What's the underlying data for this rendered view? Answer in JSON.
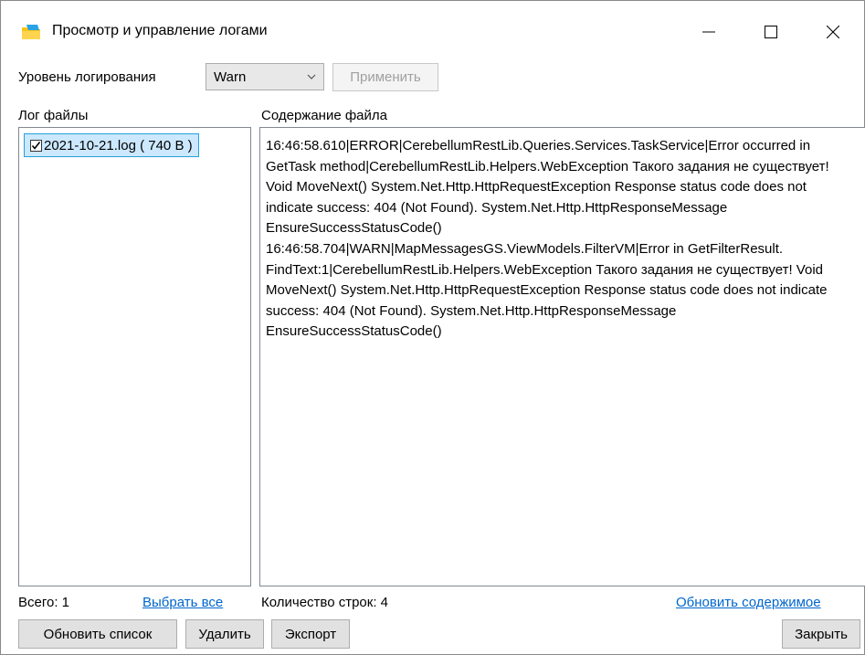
{
  "window": {
    "title": "Просмотр и управление логами",
    "minimize_symbol": "—",
    "maximize_symbol": "☐",
    "close_symbol": "✕"
  },
  "toolbar": {
    "level_label": "Уровень логирования",
    "level_value": "Warn",
    "apply_label": "Применить"
  },
  "files_panel": {
    "header": "Лог файлы",
    "items": [
      {
        "label": "2021-10-21.log ( 740 B )",
        "checked": true
      }
    ],
    "total_label": "Всего: 1",
    "select_all_label": "Выбрать все"
  },
  "content_panel": {
    "header": "Содержание файла",
    "text": "16:46:58.610|ERROR|CerebellumRestLib.Queries.Services.TaskService|Error occurred in GetTask method|CerebellumRestLib.Helpers.WebException Такого задания не существует! Void MoveNext() System.Net.Http.HttpRequestException Response status code does not indicate success: 404 (Not Found). System.Net.Http.HttpResponseMessage EnsureSuccessStatusCode()\n16:46:58.704|WARN|MapMessagesGS.ViewModels.FilterVM|Error in GetFilterResult. FindText:1|CerebellumRestLib.Helpers.WebException Такого задания не существует! Void MoveNext() System.Net.Http.HttpRequestException Response status code does not indicate success: 404 (Not Found). System.Net.Http.HttpResponseMessage EnsureSuccessStatusCode()",
    "lines_count_label": "Количество строк: 4",
    "refresh_content_label": "Обновить содержимое"
  },
  "buttons": {
    "refresh_list": "Обновить список",
    "delete": "Удалить",
    "export": "Экспорт",
    "close": "Закрыть"
  },
  "colors": {
    "link": "#0066cc",
    "selection_bg": "#cce8ff",
    "selection_border": "#26a0da"
  },
  "icons": {
    "app": "folder-icon",
    "dropdown": "chevron-down-icon"
  }
}
